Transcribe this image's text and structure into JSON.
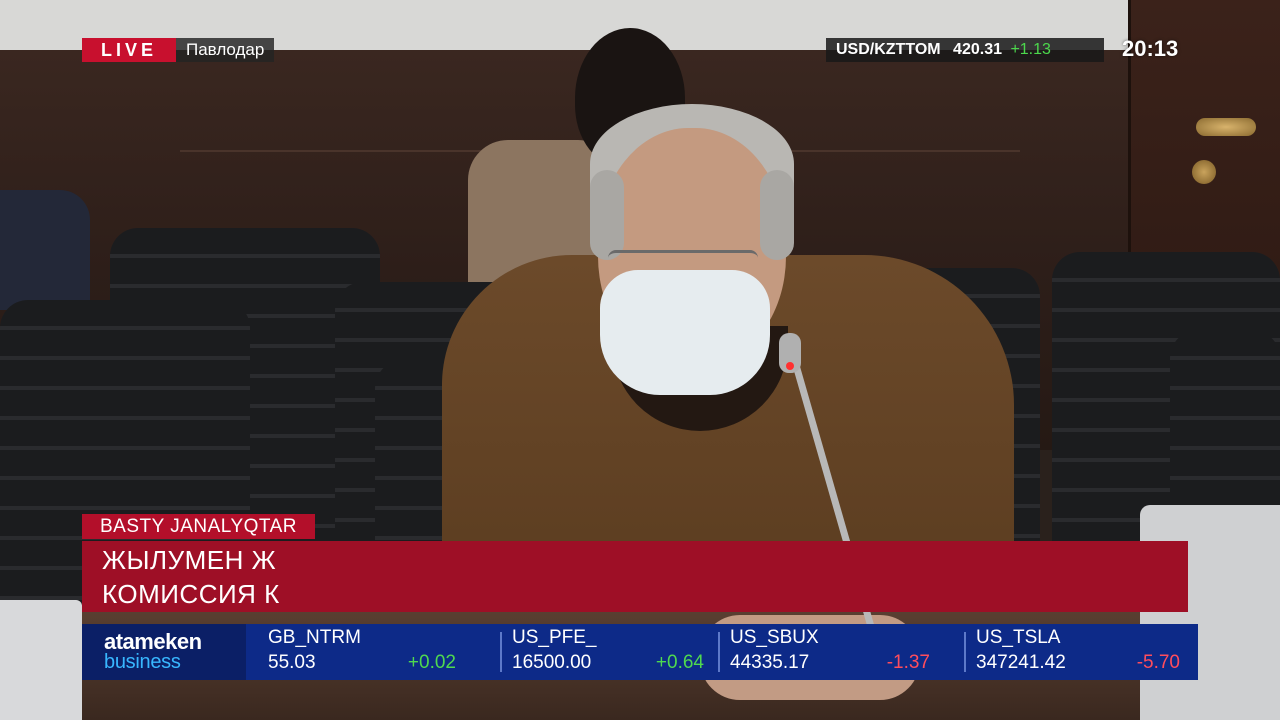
{
  "overlay": {
    "live_label": "LIVE",
    "location": "Павлодар",
    "currency": {
      "pair": "USD/KZTTOM",
      "value": "420.31",
      "change": "+1.13"
    },
    "clock": "20:13"
  },
  "news": {
    "category": "BASTY JANALYQTAR",
    "headline_line1": "ЖЫЛУМЕН Ж",
    "headline_line2": "КОМИССИЯ К"
  },
  "ticker": {
    "logo_top": "atameken",
    "logo_bottom": "business",
    "items": [
      {
        "symbol": "GB_NTRM",
        "price": "55.03",
        "change": "+0.02",
        "direction": "up"
      },
      {
        "symbol": "US_PFE_",
        "price": "16500.00",
        "change": "+0.64",
        "direction": "up"
      },
      {
        "symbol": "US_SBUX",
        "price": "44335.17",
        "change": "-1.37",
        "direction": "down"
      },
      {
        "symbol": "US_TSLA",
        "price": "347241.42",
        "change": "-5.70",
        "direction": "down"
      }
    ]
  },
  "colors": {
    "live_red": "#c8102e",
    "headline_red": "#9e0f26",
    "ticker_blue": "#0d2a88",
    "positive": "#4fd94f",
    "negative": "#ff4d5c"
  }
}
